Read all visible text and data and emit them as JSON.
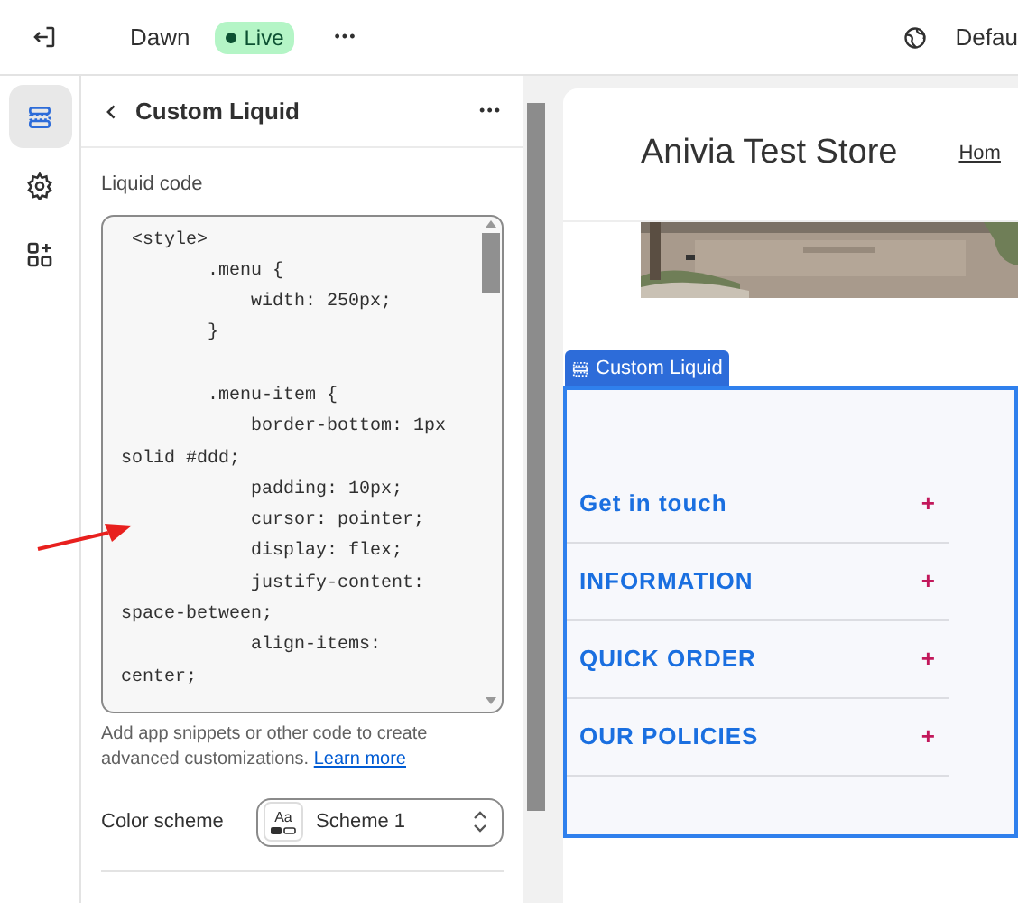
{
  "topbar": {
    "theme_name": "Dawn",
    "status_badge": "Live",
    "more": "•••",
    "preview_label": "Defau"
  },
  "rail": [
    {
      "kind": "sections",
      "selected": true
    },
    {
      "kind": "settings",
      "selected": false
    },
    {
      "kind": "apps",
      "selected": false
    }
  ],
  "panel": {
    "title": "Custom Liquid",
    "more": "•••",
    "field_label": "Liquid code",
    "code_blocks": [
      [
        " <style>",
        "        .menu {",
        "            width: 250px;",
        "        }"
      ],
      [
        "        .menu-item {",
        "            border-bottom: 1px",
        "solid #ddd;",
        "            padding: 10px;",
        "            cursor: pointer;",
        "            display: flex;",
        "            justify-content:",
        "space-between;",
        "            align-items:",
        "center;"
      ]
    ],
    "help_text": "Add app snippets or other code to create advanced customizations.",
    "help_link": "Learn more",
    "color_scheme_label": "Color scheme",
    "color_scheme_value": "Scheme 1",
    "color_scheme_icon_text": "Aa"
  },
  "preview": {
    "store_name": "Anivia Test Store",
    "nav_link": "Hom",
    "section_tag": "Custom Liquid",
    "menu_items": [
      {
        "label": "Get in touch",
        "expander": "+"
      },
      {
        "label": "INFORMATION",
        "expander": "+"
      },
      {
        "label": "QUICK ORDER",
        "expander": "+"
      },
      {
        "label": "OUR POLICIES",
        "expander": "+"
      }
    ]
  }
}
